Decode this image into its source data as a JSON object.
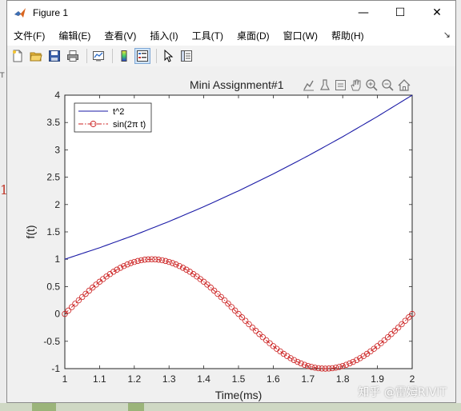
{
  "window": {
    "title": "Figure 1",
    "controls": {
      "minimize": "—",
      "maximize": "☐",
      "close": "✕"
    }
  },
  "menubar": {
    "items": [
      "文件(F)",
      "编辑(E)",
      "查看(V)",
      "插入(I)",
      "工具(T)",
      "桌面(D)",
      "窗口(W)",
      "帮助(H)"
    ],
    "overflow": "↘"
  },
  "toolbar": {
    "icons": [
      "new-figure-icon",
      "open-file-icon",
      "save-icon",
      "print-icon",
      "link-plot-icon",
      "colorbar-icon",
      "legend-icon",
      "select-arrow-icon",
      "property-inspector-icon"
    ],
    "active": "legend-icon"
  },
  "axes_toolbar": {
    "icons": [
      "export-icon",
      "brush-icon",
      "data-tip-icon",
      "pan-icon",
      "zoom-in-icon",
      "zoom-out-icon",
      "home-icon"
    ]
  },
  "background_text": {
    "left_red": "1",
    "left_small": "T"
  },
  "watermark": "知乎 @雷姆RIVIT",
  "colors": {
    "series1": "#1a1aa6",
    "series2": "#cc2222",
    "axes_bg": "#ffffff",
    "figure_bg": "#f0f0f0"
  },
  "chart_data": {
    "type": "line",
    "title": "Mini Assignment#1",
    "xlabel": "Time(ms)",
    "ylabel": "f(t)",
    "xlim": [
      1,
      2
    ],
    "ylim": [
      -1,
      4
    ],
    "xticks": [
      1,
      1.1,
      1.2,
      1.3,
      1.4,
      1.5,
      1.6,
      1.7,
      1.8,
      1.9,
      2
    ],
    "xtick_labels": [
      "1",
      "1.1",
      "1.2",
      "1.3",
      "1.4",
      "1.5",
      "1.6",
      "1.7",
      "1.8",
      "1.9",
      "2"
    ],
    "yticks": [
      -1,
      -0.5,
      0,
      0.5,
      1,
      1.5,
      2,
      2.5,
      3,
      3.5,
      4
    ],
    "ytick_labels": [
      "-1",
      "-0.5",
      "0",
      "0.5",
      "1",
      "1.5",
      "2",
      "2.5",
      "3",
      "3.5",
      "4"
    ],
    "grid": false,
    "legend": "top-left",
    "series": [
      {
        "name": "t^2",
        "style": "solid line",
        "color": "#1a1aa6",
        "x": [
          1,
          1.1,
          1.2,
          1.3,
          1.4,
          1.5,
          1.6,
          1.7,
          1.8,
          1.9,
          2
        ],
        "y": [
          1,
          1.21,
          1.44,
          1.69,
          1.96,
          2.25,
          2.56,
          2.89,
          3.24,
          3.61,
          4
        ]
      },
      {
        "name": "sin(2π t)",
        "style": "dash-dot line with circle markers",
        "color": "#cc2222",
        "x": [
          1,
          1.05,
          1.1,
          1.15,
          1.2,
          1.25,
          1.3,
          1.35,
          1.4,
          1.45,
          1.5,
          1.55,
          1.6,
          1.65,
          1.7,
          1.75,
          1.8,
          1.85,
          1.9,
          1.95,
          2
        ],
        "y": [
          0,
          0.309,
          0.588,
          0.809,
          0.951,
          1,
          0.951,
          0.809,
          0.588,
          0.309,
          0,
          -0.309,
          -0.588,
          -0.809,
          -0.951,
          -1,
          -0.951,
          -0.809,
          -0.588,
          -0.309,
          0
        ]
      }
    ]
  }
}
